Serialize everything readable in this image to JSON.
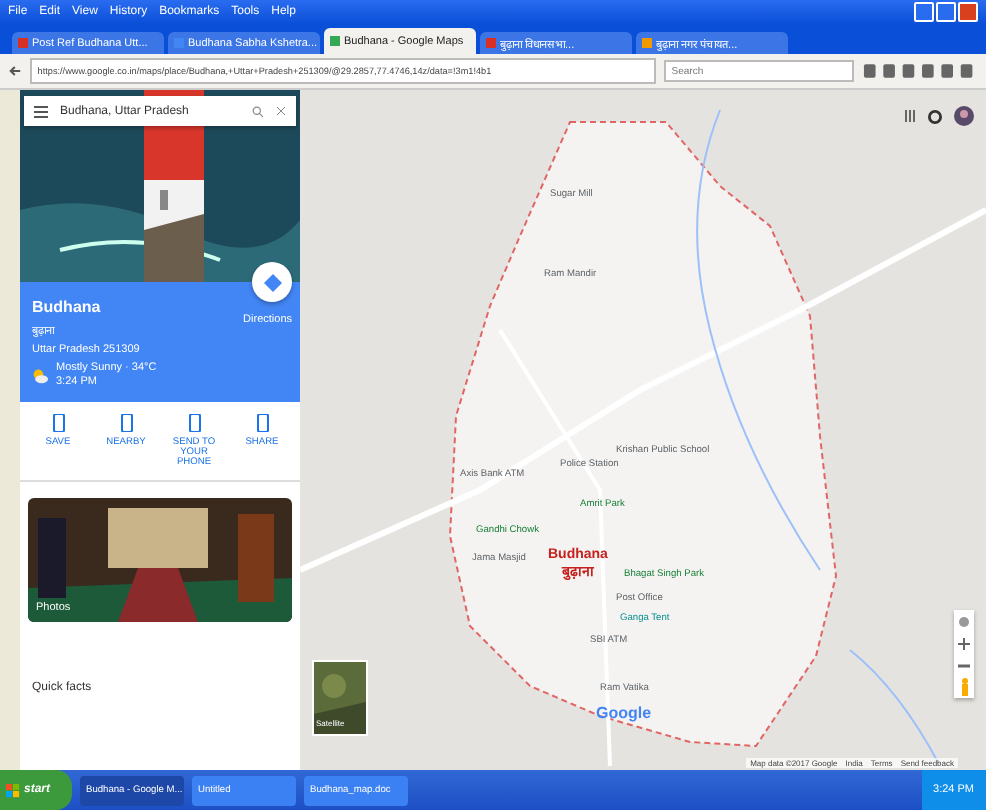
{
  "menu": [
    "File",
    "Edit",
    "View",
    "History",
    "Bookmarks",
    "Tools",
    "Help"
  ],
  "tabs": [
    {
      "label": "Post Ref Budhana Utt...",
      "selected": false
    },
    {
      "label": "Budhana Sabha Kshetra...",
      "selected": false
    },
    {
      "label": "Budhana - Google Maps",
      "selected": true
    },
    {
      "label": "बुढ़ाना विधानसभा...",
      "selected": false
    },
    {
      "label": "बुढ़ाना नगर पंचायत...",
      "selected": false
    }
  ],
  "address": "https://www.google.co.in/maps/place/Budhana,+Uttar+Pradesh+251309/@29.2857,77.4746,14z/data=!3m1!4b1",
  "browser_search": {
    "placeholder": "Search"
  },
  "place_search": "Budhana, Uttar Pradesh",
  "place": {
    "name": "Budhana",
    "local_name": "बुढ़ाना",
    "address": "Uttar Pradesh 251309",
    "directions": "Directions",
    "weather": "Mostly Sunny · 34°C",
    "time": "3:24 PM"
  },
  "actions": [
    "SAVE",
    "NEARBY",
    "SEND TO YOUR PHONE",
    "SHARE"
  ],
  "photos_label": "Photos",
  "quick_facts": "Quick facts",
  "map": {
    "labels": [
      {
        "text": "Sugar Mill",
        "kind": "place"
      },
      {
        "text": "Police Station",
        "kind": "place"
      },
      {
        "text": "Axis Bank ATM",
        "kind": "place"
      },
      {
        "text": "Jama Masjid",
        "kind": "place"
      },
      {
        "text": "Krishan Public School",
        "kind": "place"
      },
      {
        "text": "Amrit Park",
        "kind": "park"
      },
      {
        "text": "Gandhi Chowk",
        "kind": "park"
      },
      {
        "text": "Post Office",
        "kind": "place"
      },
      {
        "text": "Ganga Tent",
        "kind": "shop"
      },
      {
        "text": "SBI ATM",
        "kind": "place"
      },
      {
        "text": "Ram Mandir",
        "kind": "place"
      },
      {
        "text": "Bhagat Singh Park",
        "kind": "park"
      },
      {
        "text": "Ram Vatika",
        "kind": "place"
      }
    ],
    "town": "Budhana",
    "town_local": "बुढ़ाना",
    "satellite": "Satellite",
    "logo": "Google",
    "attribution": [
      "Map data ©2017 Google",
      "India",
      "Terms",
      "Send feedback"
    ]
  },
  "taskbar": {
    "start": "start",
    "items": [
      {
        "label": "Budhana - Google M...",
        "selected": true
      },
      {
        "label": "Untitled",
        "selected": false
      },
      {
        "label": "Budhana_map.doc",
        "selected": false
      }
    ],
    "clock": "3:24 PM"
  }
}
